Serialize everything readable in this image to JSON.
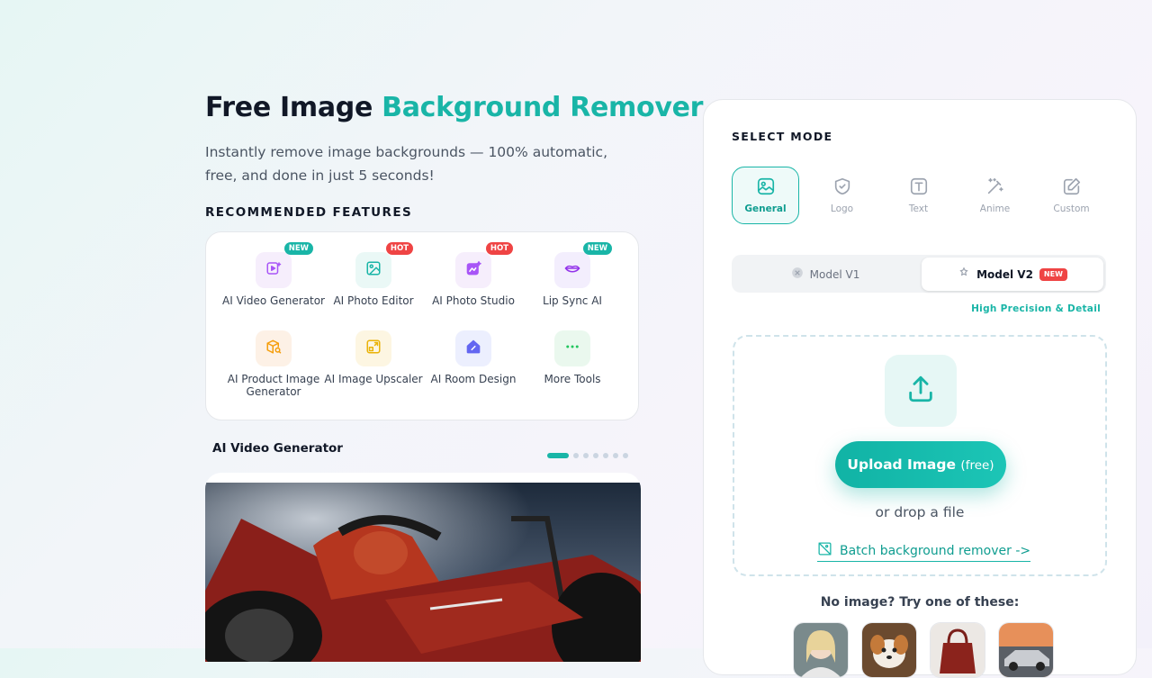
{
  "hero": {
    "title_plain": "Free Image ",
    "title_accent": "Background Remover",
    "subtitle": "Instantly remove image backgrounds — 100% automatic, free, and done in just 5 seconds!"
  },
  "recommended": {
    "label": "RECOMMENDED FEATURES",
    "items": [
      {
        "label": "AI Video Generator",
        "badge": "NEW",
        "icon": "video-sparkle-icon"
      },
      {
        "label": "AI Photo Editor",
        "badge": "HOT",
        "icon": "photo-icon"
      },
      {
        "label": "AI Photo Studio",
        "badge": "HOT",
        "icon": "photo-studio-icon"
      },
      {
        "label": "Lip Sync AI",
        "badge": "NEW",
        "icon": "lips-icon"
      },
      {
        "label": "AI Product Image Generator",
        "badge": "",
        "icon": "product-box-icon"
      },
      {
        "label": "AI Image Upscaler",
        "badge": "",
        "icon": "upscale-icon"
      },
      {
        "label": "AI Room Design",
        "badge": "",
        "icon": "room-design-icon"
      },
      {
        "label": "More Tools",
        "badge": "",
        "icon": "more-dots-icon"
      }
    ]
  },
  "carousel": {
    "title": "AI Video Generator",
    "slide_count": 7,
    "active_index": 0
  },
  "panel": {
    "mode_label": "SELECT MODE",
    "modes": [
      {
        "label": "General",
        "active": true
      },
      {
        "label": "Logo",
        "active": false
      },
      {
        "label": "Text",
        "active": false
      },
      {
        "label": "Anime",
        "active": false
      },
      {
        "label": "Custom",
        "active": false
      }
    ],
    "models": {
      "v1": "Model V1",
      "v2": "Model V2",
      "v2_badge": "NEW",
      "selected": "v2"
    },
    "precision_note": "High Precision & Detail",
    "upload": {
      "button_main": "Upload Image",
      "button_free": "(free)",
      "drop_text": "or drop a file",
      "batch_link": "Batch background remover ->"
    },
    "samples": {
      "prompt": "No image? Try one of these:",
      "count": 4
    }
  },
  "colors": {
    "accent": "#19b5a7",
    "hot_badge": "#ef4444"
  }
}
